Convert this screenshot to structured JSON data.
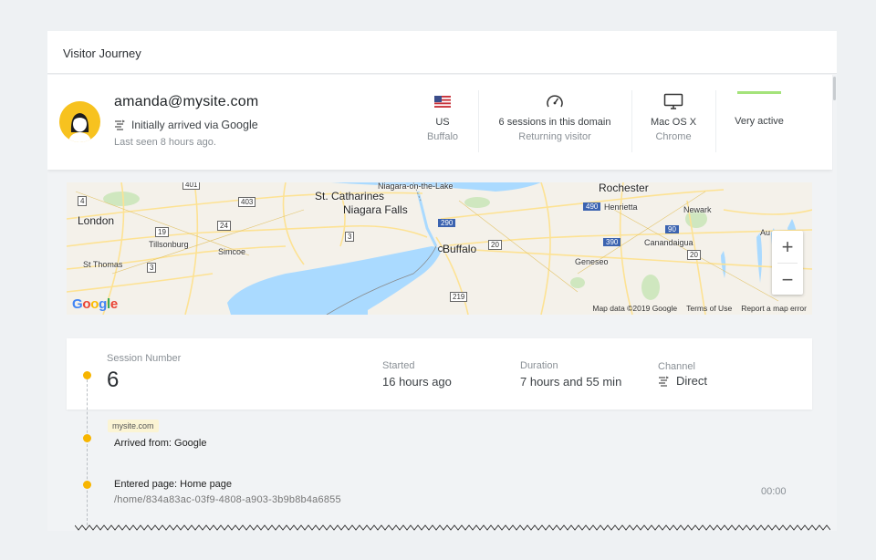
{
  "panel": {
    "title": "Visitor Journey"
  },
  "visitor": {
    "email": "amanda@mysite.com",
    "arrived_prefix": "Initially arrived via",
    "arrived_source": "Google",
    "last_seen": "Last seen 8 hours ago."
  },
  "stats": {
    "location": {
      "icon": "us-flag-icon",
      "line1": "US",
      "line2": "Buffalo"
    },
    "sessions": {
      "icon": "speedometer-icon",
      "line1": "6 sessions in this domain",
      "line2": "Returning visitor"
    },
    "device": {
      "icon": "monitor-icon",
      "line1": "Mac OS X",
      "line2": "Chrome"
    },
    "activity": {
      "line1": "Very active",
      "bar_color": "#a4e37a",
      "level": 1.0
    }
  },
  "map": {
    "labels": [
      "Niagara-on-the-Lake",
      "Rochester",
      "St. Catharines",
      "Niagara Falls",
      "London",
      "Henrietta",
      "Newark",
      "Buffalo",
      "Canandaigua",
      "Au",
      "Tillsonburg",
      "Simcoe",
      "Geneseo",
      "St Thomas"
    ],
    "routes": [
      "4",
      "401",
      "403",
      "24",
      "19",
      "3",
      "3",
      "290",
      "490",
      "90",
      "20",
      "390",
      "20",
      "219"
    ],
    "provider": "Google",
    "footer": [
      "Map data ©2019 Google",
      "Terms of Use",
      "Report a map error"
    ],
    "zoom_in": "+",
    "zoom_out": "−"
  },
  "session": {
    "number_label": "Session Number",
    "number": "6",
    "started_label": "Started",
    "started": "16 hours ago",
    "duration_label": "Duration",
    "duration": "7 hours and 55 min",
    "channel_label": "Channel",
    "channel": "Direct"
  },
  "events": {
    "domain": "mysite.com",
    "arrived": "Arrived from: Google",
    "entered": "Entered page: Home page",
    "path": "/home/834a83ac-03f9-4808-a903-3b9b8b4a6855",
    "time": "00:00"
  },
  "colors": {
    "accent": "#f7b500",
    "avatar_bg": "#f7c21f",
    "active_bar": "#a4e37a",
    "water": "#aadaff"
  }
}
